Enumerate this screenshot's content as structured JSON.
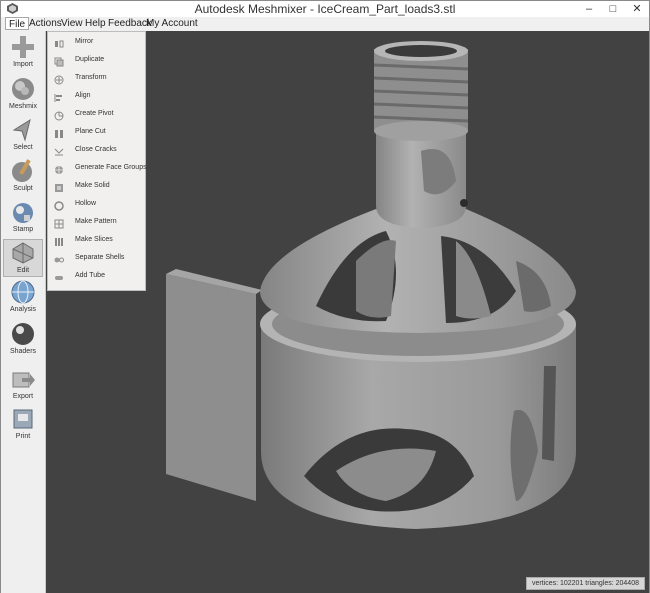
{
  "window": {
    "title": "Autodesk Meshmixer - IceCream_Part_loads3.stl",
    "controls": [
      "minimize",
      "maximize",
      "close"
    ]
  },
  "menubar": [
    "File",
    "Actions",
    "View",
    "Help",
    "Feedback",
    "My Account"
  ],
  "toolbar": [
    "Import",
    "Meshmix",
    "Select",
    "Sculpt",
    "Stamp",
    "Edit",
    "Analysis",
    "Shaders",
    "Export",
    "Print"
  ],
  "edit_menu": [
    "Mirror",
    "Duplicate",
    "Transform",
    "Align",
    "Create Pivot",
    "Plane Cut",
    "Close Cracks",
    "Generate Face Groups",
    "Make Solid",
    "Hollow",
    "Make Pattern",
    "Make Slices",
    "Separate Shells",
    "Add Tube"
  ],
  "status": "vertices: 102201 triangles: 204408",
  "colors": {
    "viewport": "#424242",
    "model": "#9a9a9a"
  }
}
